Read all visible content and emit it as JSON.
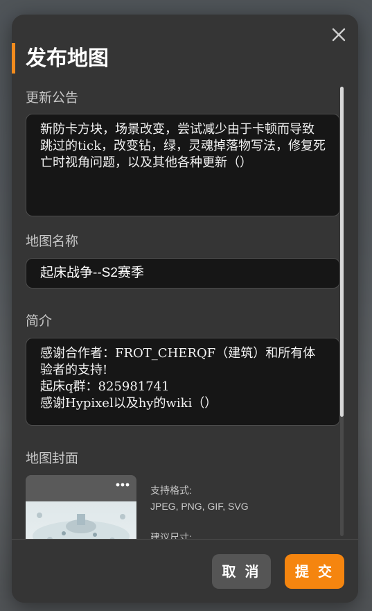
{
  "dialog": {
    "title": "发布地图",
    "close_icon": "close-icon"
  },
  "fields": {
    "update_notes": {
      "label": "更新公告",
      "value": "新防卡方块，场景改变，尝试减少由于卡顿而导致跳过的tick，改变钻，绿，灵魂掉落物写法，修复死亡时视角问题，以及其他各种更新（）"
    },
    "map_name": {
      "label": "地图名称",
      "value": "起床战争--S2赛季"
    },
    "intro": {
      "label": "简介",
      "value": "感谢合作者：FROT_CHERQF（建筑）和所有体验者的支持!\n起床q群：825981741\n感谢Hypixel以及hy的wiki（）"
    },
    "cover": {
      "label": "地图封面",
      "more_icon": "more-dots-icon",
      "formats_label": "支持格式:",
      "formats": "JPEG, PNG, GIF, SVG",
      "size_label": "建议尺寸:"
    }
  },
  "footer": {
    "cancel_label": "取 消",
    "submit_label": "提 交"
  },
  "colors": {
    "accent": "#f28b1d",
    "submit": "#f5850f",
    "dialog_bg": "#353535",
    "field_bg": "#161616"
  }
}
